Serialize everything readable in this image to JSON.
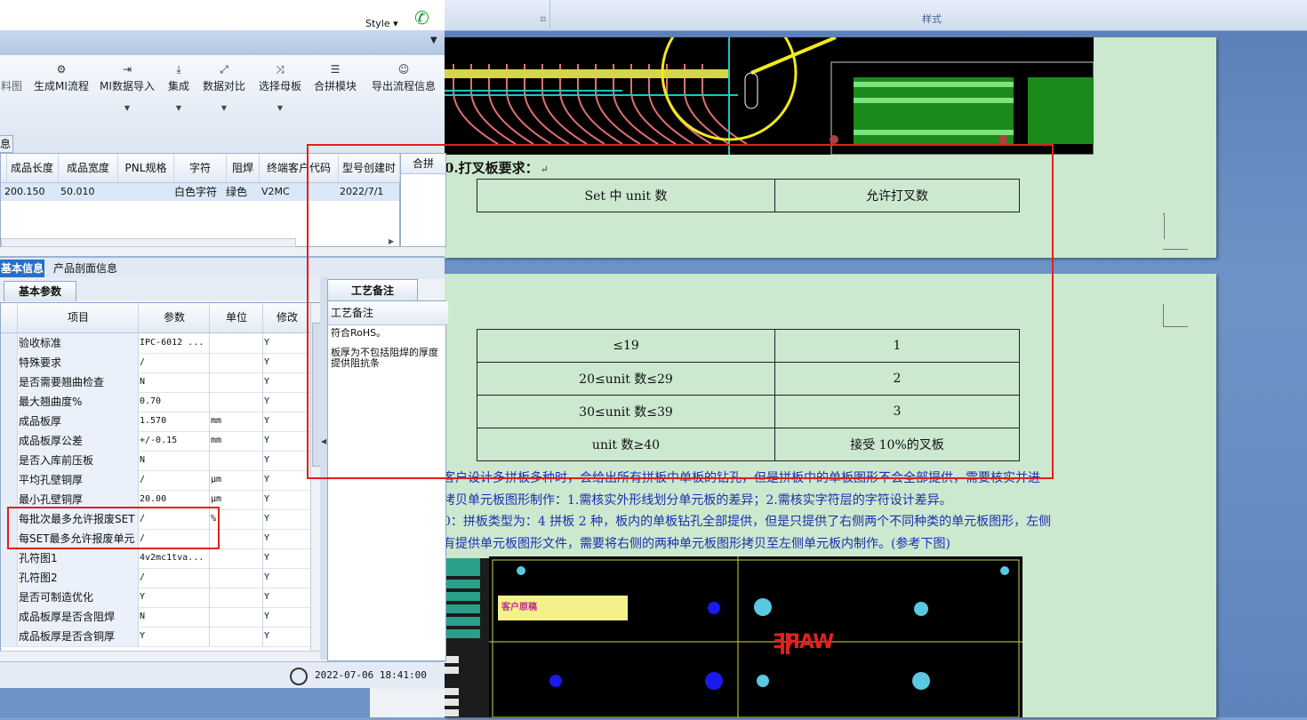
{
  "app": {
    "style_label": "Style ▾",
    "tabstrip_arrow": "▼",
    "toolbar": [
      {
        "icon": "flow-icon",
        "label": "料图",
        "x": 0,
        "w": 24,
        "has_dropdown": false
      },
      {
        "icon": "gears-icon",
        "label": "生成MI流程",
        "glyph": "⚙",
        "has_dropdown": false
      },
      {
        "icon": "import-icon",
        "label": "MI数据导入",
        "glyph": "⇥",
        "has_dropdown": true
      },
      {
        "icon": "integrate-icon",
        "label": "集成",
        "glyph": "⤓",
        "has_dropdown": true
      },
      {
        "icon": "compare-icon",
        "label": "数据对比",
        "glyph": "⤢",
        "has_dropdown": true
      },
      {
        "icon": "shuffle-icon",
        "label": "选择母板",
        "glyph": "⤨",
        "has_dropdown": true
      },
      {
        "icon": "list-icon",
        "label": "合拼模块",
        "glyph": "☰",
        "has_dropdown": false
      },
      {
        "icon": "smile-icon",
        "label": "导出流程信息",
        "glyph": "☺",
        "has_dropdown": false
      }
    ],
    "info_tab": "息",
    "grid1": {
      "headers": [
        "成品长度",
        "成品宽度",
        "PNL规格",
        "字符",
        "阻焊",
        "终端客户代码",
        "型号创建时"
      ],
      "row": [
        "200.150",
        "50.010",
        "",
        "白色字符",
        "绿色",
        "V2MC",
        "2022/7/1"
      ]
    },
    "side_panel_title": "合拼",
    "lower_tabs": {
      "basic_info": "基本信息",
      "profile": "产品剖面信息"
    },
    "subtab_basic": "基本参数",
    "params": {
      "headers": [
        "项目",
        "参数",
        "单位",
        "修改"
      ],
      "rows": [
        [
          "验收标准",
          "IPC-6012 ...",
          "",
          "Y"
        ],
        [
          "特殊要求",
          "/",
          "",
          "Y"
        ],
        [
          "是否需要翘曲检查",
          "N",
          "",
          "Y"
        ],
        [
          "最大翘曲度%",
          "0.70",
          "",
          "Y"
        ],
        [
          "成品板厚",
          "1.570",
          "mm",
          "Y"
        ],
        [
          "成品板厚公差",
          "+/-0.15",
          "mm",
          "Y"
        ],
        [
          "是否入库前压板",
          "N",
          "",
          "Y"
        ],
        [
          "平均孔壁铜厚",
          "/",
          "μm",
          "Y"
        ],
        [
          "最小孔壁铜厚",
          "20.00",
          "μm",
          "Y"
        ],
        [
          "每批次最多允许报废SET",
          "/",
          "%",
          "Y"
        ],
        [
          "每SET最多允许报废单元",
          "/",
          "",
          "Y"
        ],
        [
          "孔符图1",
          "4v2mc1tva...",
          "",
          "Y"
        ],
        [
          "孔符图2",
          "/",
          "",
          "Y"
        ],
        [
          "是否可制造优化",
          "Y",
          "",
          "Y"
        ],
        [
          "成品板厚是否含阻焊",
          "N",
          "",
          "Y"
        ],
        [
          "成品板厚是否含铜厚",
          "Y",
          "",
          "Y"
        ]
      ]
    },
    "notes": {
      "tab": "工艺备注",
      "header": "工艺备注",
      "lines": [
        "符合RoHS。",
        "板厚为不包括阻焊的厚度",
        "提供阻抗条"
      ]
    },
    "status_time": "2022-07-06  18:41:00"
  },
  "document": {
    "ribbon_caption": "样式",
    "heading": "0.打叉板要求：",
    "table_header": [
      "Set 中 unit 数",
      "允许打叉数"
    ],
    "table_rows": [
      [
        "≤19",
        "1"
      ],
      [
        "20≤unit 数≤29",
        "2"
      ],
      [
        "30≤unit 数≤39",
        "3"
      ],
      [
        "unit 数≥40",
        "接受 10%的叉板"
      ]
    ],
    "para_lines": [
      "  客户设计多拼板多种时，会给出所有拼板中单板的钻孔，但是拼板中的单板图形不会全部提供，需要核实并进",
      "拷贝单元板图形制作：1.需核实外形线划分单元板的差异；2.需核实字符层的字符设计差异。",
      "0：拼板类型为：4 拼板 2 种，板内的单板钻孔全部提供，但是只提供了右侧两个不同种类的单元板图形，左侧",
      "有提供单元板图形文件，需要将右侧的两种单元板图形拷贝至左侧单元板内制作。(参考下图)"
    ],
    "image_label": "客户原稿",
    "logo_text": "WARE"
  }
}
